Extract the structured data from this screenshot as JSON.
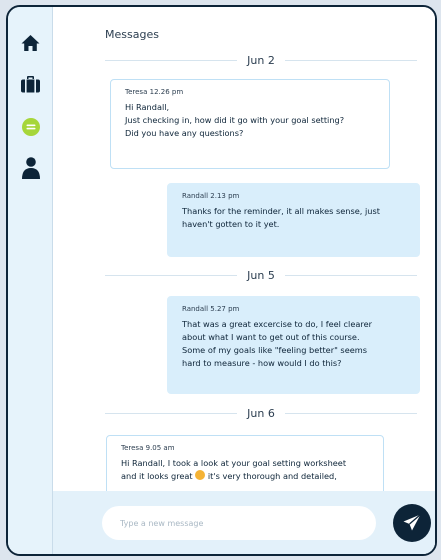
{
  "sidebar": {
    "items": [
      {
        "name": "home",
        "icon": "home-icon"
      },
      {
        "name": "courses",
        "icon": "briefcase-icon"
      },
      {
        "name": "messages",
        "icon": "chat-bubble-icon",
        "active": true
      },
      {
        "name": "profile",
        "icon": "person-icon"
      }
    ]
  },
  "colors": {
    "navy": "#0d2438",
    "active": "#a6d63a",
    "sidebar": "#e6f3fb",
    "bubble_out": "#d9eefb"
  },
  "header": {
    "title": "Messages"
  },
  "dates": [
    "Jun 2",
    "Jun 5",
    "Jun 6"
  ],
  "messages": [
    {
      "sender": "Teresa",
      "time": "12.26 pm",
      "direction": "in",
      "lines": [
        "Hi Randall,",
        "Just checking in, how did it go with your goal setting?",
        "Did you have any questions?"
      ]
    },
    {
      "sender": "Randall",
      "time": "2.13 pm",
      "direction": "out",
      "lines": [
        "Thanks for the reminder, it all makes sense, just",
        "haven't gotten to it yet."
      ]
    },
    {
      "sender": "Randall",
      "time": "5.27 pm",
      "direction": "out",
      "lines": [
        "That was a great excercise to do, I feel clearer",
        "about what I want to get out of this course.",
        "Some of my goals like \"feeling better\" seems",
        "hard to measure - how would I do this?"
      ]
    },
    {
      "sender": "Teresa",
      "time": "9.05 am",
      "direction": "in",
      "lines": [
        "Hi Randall, I took a look at your goal setting worksheet",
        "and it looks great",
        "it's very thorough and detailed,"
      ]
    }
  ],
  "composer": {
    "placeholder": "Type a new message",
    "send_icon": "paper-plane-icon"
  }
}
